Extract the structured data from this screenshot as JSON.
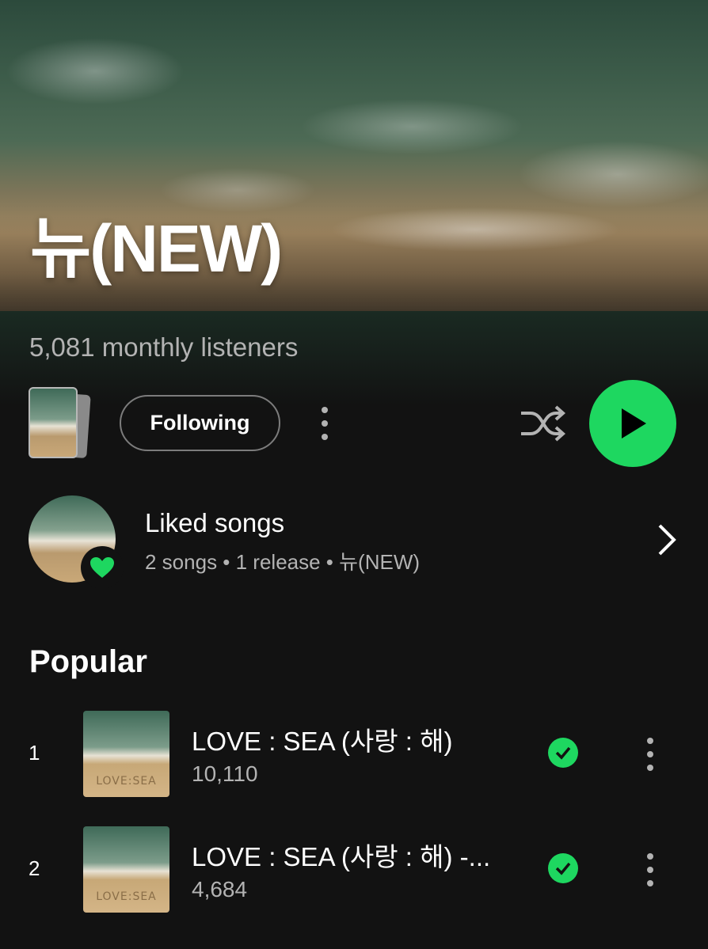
{
  "artist": {
    "name": "뉴(NEW)",
    "monthly_listeners": "5,081 monthly listeners"
  },
  "actions": {
    "follow_label": "Following"
  },
  "liked": {
    "title": "Liked songs",
    "subtitle": "2 songs • 1 release • 뉴(NEW)"
  },
  "popular": {
    "heading": "Popular",
    "tracks": [
      {
        "rank": "1",
        "title": "LOVE : SEA (사랑 : 해)",
        "plays": "10,110",
        "cover_text": "LOVE:SEA"
      },
      {
        "rank": "2",
        "title": "LOVE : SEA (사랑 : 해) -...",
        "plays": "4,684",
        "cover_text": "LOVE:SEA"
      }
    ]
  },
  "colors": {
    "accent": "#1ed760",
    "background": "#121212",
    "secondary_text": "#b3b3b3"
  },
  "icons": {
    "more": "more-vertical-icon",
    "shuffle": "shuffle-icon",
    "play": "play-icon",
    "heart": "heart-icon",
    "chevron": "chevron-right-icon",
    "downloaded": "check-circle-icon"
  }
}
